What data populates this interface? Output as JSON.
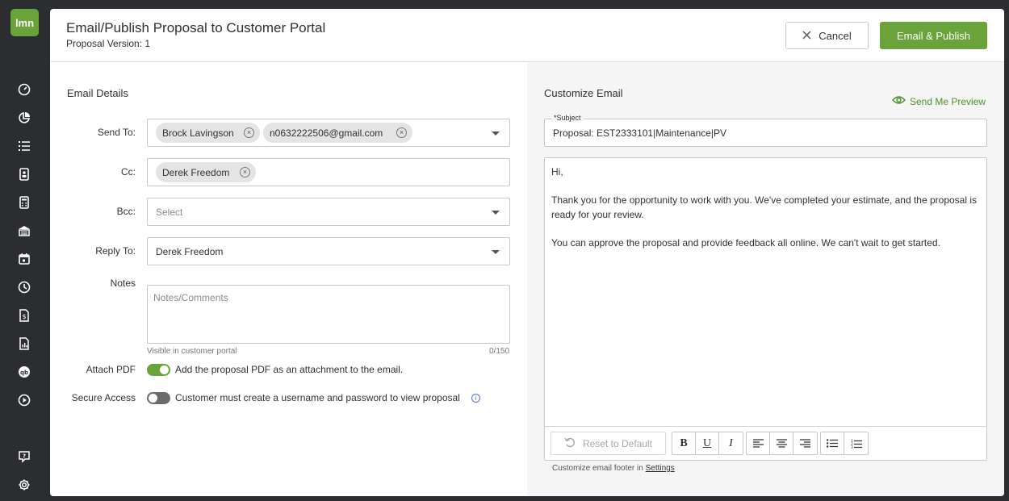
{
  "app": {
    "logo_text": "lmn"
  },
  "sidebar": {
    "items": [
      {
        "icon": "dashboard-icon"
      },
      {
        "icon": "pie-chart-icon"
      },
      {
        "icon": "list-icon"
      },
      {
        "icon": "contact-card-icon"
      },
      {
        "icon": "calculator-icon"
      },
      {
        "icon": "building-icon"
      },
      {
        "icon": "calendar-icon"
      },
      {
        "icon": "clock-icon"
      },
      {
        "icon": "invoice-dollar-icon"
      },
      {
        "icon": "report-icon"
      },
      {
        "icon": "quickbooks-icon"
      },
      {
        "icon": "play-circle-icon"
      },
      {
        "icon": "help-chat-icon"
      },
      {
        "icon": "gear-icon"
      }
    ]
  },
  "header": {
    "title": "Email/Publish Proposal to Customer Portal",
    "subtitle": "Proposal Version: 1",
    "cancel_label": "Cancel",
    "publish_label": "Email & Publish"
  },
  "email_details": {
    "title": "Email Details",
    "send_to": {
      "label": "Send To:",
      "chips": [
        "Brock Lavingson",
        "n0632222506@gmail.com"
      ]
    },
    "cc": {
      "label": "Cc:",
      "chips": [
        "Derek Freedom"
      ]
    },
    "bcc": {
      "label": "Bcc:",
      "placeholder": "Select"
    },
    "reply_to": {
      "label": "Reply To:",
      "value": "Derek Freedom"
    },
    "notes": {
      "label": "Notes",
      "placeholder": "Notes/Comments",
      "hint": "Visible in customer portal",
      "counter": "0/150"
    },
    "attach_pdf": {
      "label": "Attach PDF",
      "text": "Add the proposal PDF as an attachment to the email.",
      "enabled": true
    },
    "secure_access": {
      "label": "Secure Access",
      "text": "Customer must create a username and password to view proposal",
      "enabled": false
    }
  },
  "customize_email": {
    "title": "Customize Email",
    "preview_label": "Send Me Preview",
    "subject_label": "*Subject",
    "subject_value": "Proposal: EST2333101|Maintenance|PV",
    "body": [
      "Hi,",
      "Thank you for the opportunity to work with you. We've completed your estimate, and the proposal is ready for your review.",
      "You can approve the proposal and provide feedback all online. We can't wait to get started."
    ],
    "reset_label": "Reset to Default",
    "format": {
      "bold": "B",
      "underline": "U",
      "italic": "I"
    },
    "footer_text": "Customize email footer in",
    "footer_link": "Settings"
  },
  "colors": {
    "accent": "#6aa33a",
    "sidebar": "#2b2d31",
    "info": "#5b6de0"
  }
}
